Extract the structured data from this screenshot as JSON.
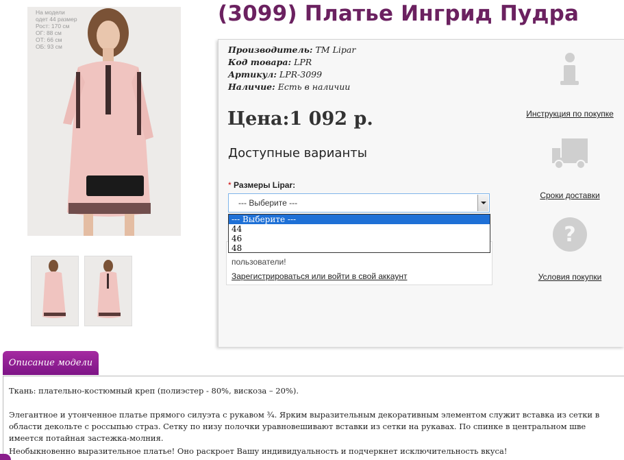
{
  "product": {
    "title": "(3099) Платье Ингрид Пудра",
    "manufacturer_label": "Производитель:",
    "manufacturer": "ТМ Lipar",
    "code_label": "Код товара:",
    "code": "LPR",
    "sku_label": "Артикул:",
    "sku": "LPR-3099",
    "stock_label": "Наличие:",
    "stock": "Есть в наличии",
    "price": "Цена:1 092 р."
  },
  "photo": {
    "measurements": [
      "На модели",
      "одет 44 размер",
      "Рост: 170 см",
      "ОГ: 88 см",
      "ОТ: 66 см",
      "ОБ: 93 см"
    ]
  },
  "options": {
    "heading": "Доступные варианты",
    "required_mark": "*",
    "size_label": "Размеры Lipar:",
    "selected": "--- Выберите ---",
    "list": [
      "--- Выберите ---",
      "44",
      "46",
      "48"
    ]
  },
  "login_notice": {
    "text": "пользователи!",
    "link": "Зарегистрироваться или войти в свой аккаунт"
  },
  "sidebar": {
    "instruction": "Инструкция по покупке",
    "delivery": "Сроки доставки",
    "terms": "Условия покупки"
  },
  "description": {
    "tab": "Описание модели",
    "p1": "Ткань: плательно-костюмный креп (полиэстер - 80%, вискоза – 20%).",
    "p2": "Элегантное и утонченное платье прямого силуэта с рукавом ¾. Ярким выразительным декоративным элементом служит вставка из сетки в области декольте с россыпью страз. Сетку по низу полочки уравновешивают вставки из сетки на рукавах. По спинке в центральном шве имеется потайная застежка-молния.",
    "p3": "Необыкновенно выразительное платье! Оно раскроет Вашу индивидуальность и подчеркнет исключительность вкуса!"
  },
  "colors": {
    "title": "#6b2160",
    "tab": "#8e1e93",
    "dress": "#f0c4c0",
    "select_highlight": "#1e70d6"
  }
}
